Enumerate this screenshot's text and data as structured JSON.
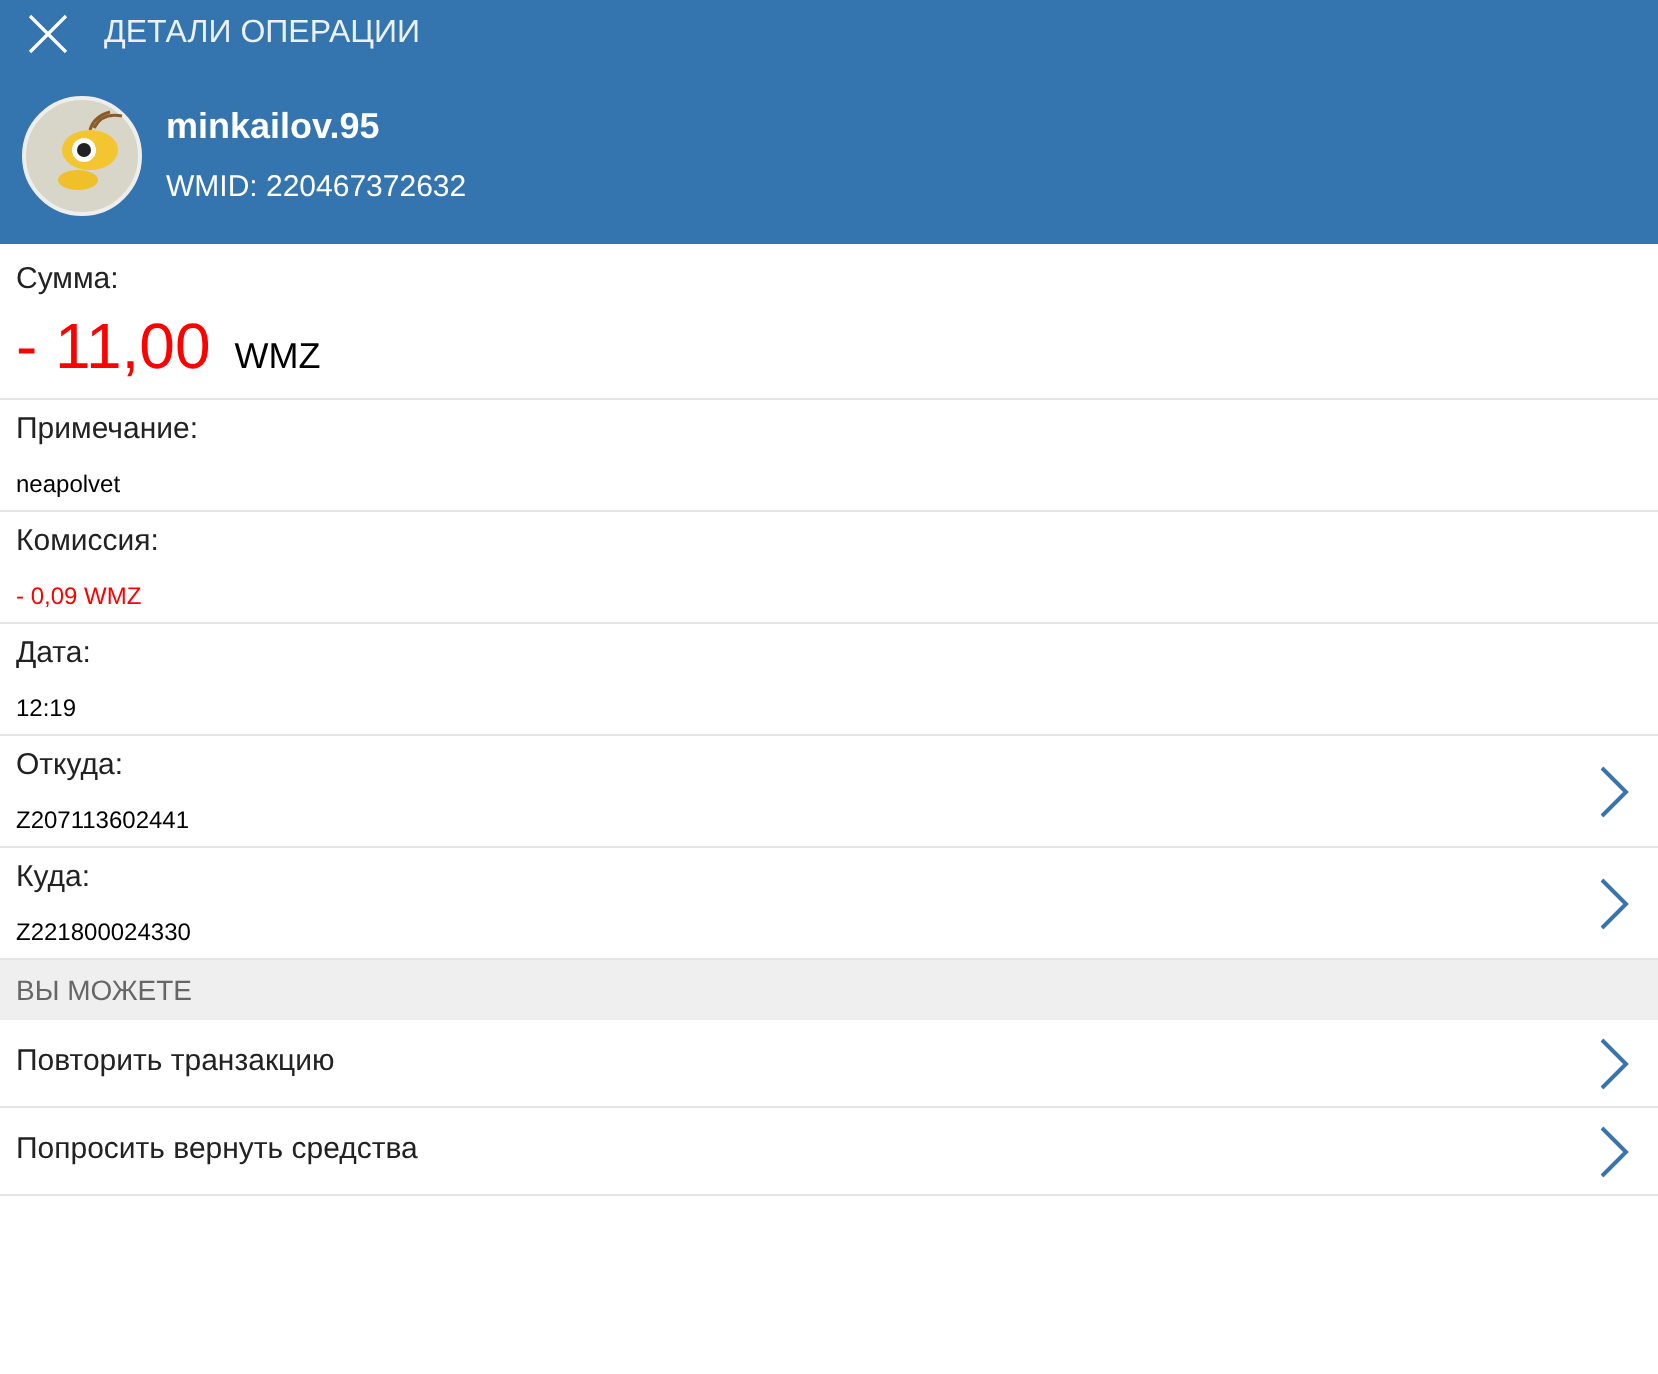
{
  "header": {
    "title": "ДЕТАЛИ ОПЕРАЦИИ"
  },
  "profile": {
    "name": "minkailov.95",
    "wmid": "WMID: 220467372632"
  },
  "fields": [
    {
      "kind": "amount",
      "label": "Сумма:",
      "value": "- 11,00",
      "unit": "WMZ",
      "navigable": false
    },
    {
      "kind": "text",
      "label": "Примечание:",
      "value": "neapolvet",
      "navigable": false
    },
    {
      "kind": "negative",
      "label": "Комиссия:",
      "value": "- 0,09 WMZ",
      "navigable": false
    },
    {
      "kind": "text",
      "label": "Дата:",
      "value": "12:19",
      "navigable": false
    },
    {
      "kind": "text",
      "label": "Откуда:",
      "value": "Z207113602441",
      "navigable": true
    },
    {
      "kind": "text",
      "label": "Куда:",
      "value": "Z221800024330",
      "navigable": true
    }
  ],
  "section": {
    "title": "ВЫ МОЖЕТЕ"
  },
  "actions": [
    {
      "label": "Повторить транзакцию"
    },
    {
      "label": "Попросить вернуть средства"
    }
  ]
}
